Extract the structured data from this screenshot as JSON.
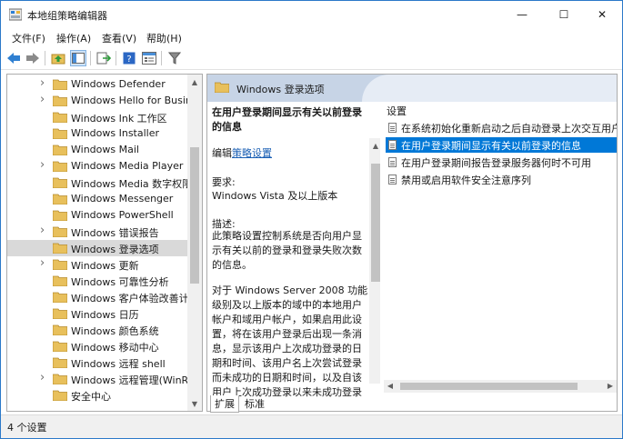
{
  "window": {
    "title": "本地组策略编辑器",
    "minimize": "—",
    "maximize": "☐",
    "close": "✕"
  },
  "menu": [
    "文件(F)",
    "操作(A)",
    "查看(V)",
    "帮助(H)"
  ],
  "tree": {
    "items": [
      {
        "label": "Windows Defender",
        "has_children": true
      },
      {
        "label": "Windows Hello for Business",
        "has_children": true
      },
      {
        "label": "Windows Ink 工作区",
        "has_children": false
      },
      {
        "label": "Windows Installer",
        "has_children": false
      },
      {
        "label": "Windows Mail",
        "has_children": false
      },
      {
        "label": "Windows Media Player",
        "has_children": true
      },
      {
        "label": "Windows Media 数字权限管理",
        "has_children": false
      },
      {
        "label": "Windows Messenger",
        "has_children": false
      },
      {
        "label": "Windows PowerShell",
        "has_children": false
      },
      {
        "label": "Windows 错误报告",
        "has_children": true
      },
      {
        "label": "Windows 登录选项",
        "has_children": false,
        "selected": true
      },
      {
        "label": "Windows 更新",
        "has_children": true
      },
      {
        "label": "Windows 可靠性分析",
        "has_children": false
      },
      {
        "label": "Windows 客户体验改善计划",
        "has_children": false
      },
      {
        "label": "Windows 日历",
        "has_children": false
      },
      {
        "label": "Windows 颜色系统",
        "has_children": false
      },
      {
        "label": "Windows 移动中心",
        "has_children": false
      },
      {
        "label": "Windows 远程 shell",
        "has_children": false
      },
      {
        "label": "Windows 远程管理(WinRM)",
        "has_children": true
      },
      {
        "label": "安全中心",
        "has_children": false
      }
    ]
  },
  "header": {
    "title": "Windows 登录选项"
  },
  "description": {
    "title": "在用户登录期间显示有关以前登录的信息",
    "edit_prefix": "编辑",
    "edit_link": "策略设置",
    "requirements_label": "要求:",
    "requirements_value": "Windows Vista 及以上版本",
    "desc_label": "描述:",
    "desc_p1": "此策略设置控制系统是否向用户显示有关以前的登录和登录失败次数的信息。",
    "desc_p2": "对于 Windows Server 2008 功能级别及以上版本的域中的本地用户帐户和域用户帐户，如果启用此设置，将在该用户登录后出现一条消息，显示该用户上次成功登录的日期和时间、该用户名上次尝试登录而未成功的日期和时间，以及自该用户上次成功登录以来未成功登录"
  },
  "settings": {
    "header": "设置",
    "items": [
      {
        "label": "在系统初始化重新启动之后自动登录上次交互用户"
      },
      {
        "label": "在用户登录期间显示有关以前登录的信息",
        "selected": true
      },
      {
        "label": "在用户登录期间报告登录服务器何时不可用"
      },
      {
        "label": "禁用或启用软件安全注意序列"
      }
    ]
  },
  "tabs": [
    "扩展",
    "标准"
  ],
  "status": {
    "text": "4 个设置"
  }
}
